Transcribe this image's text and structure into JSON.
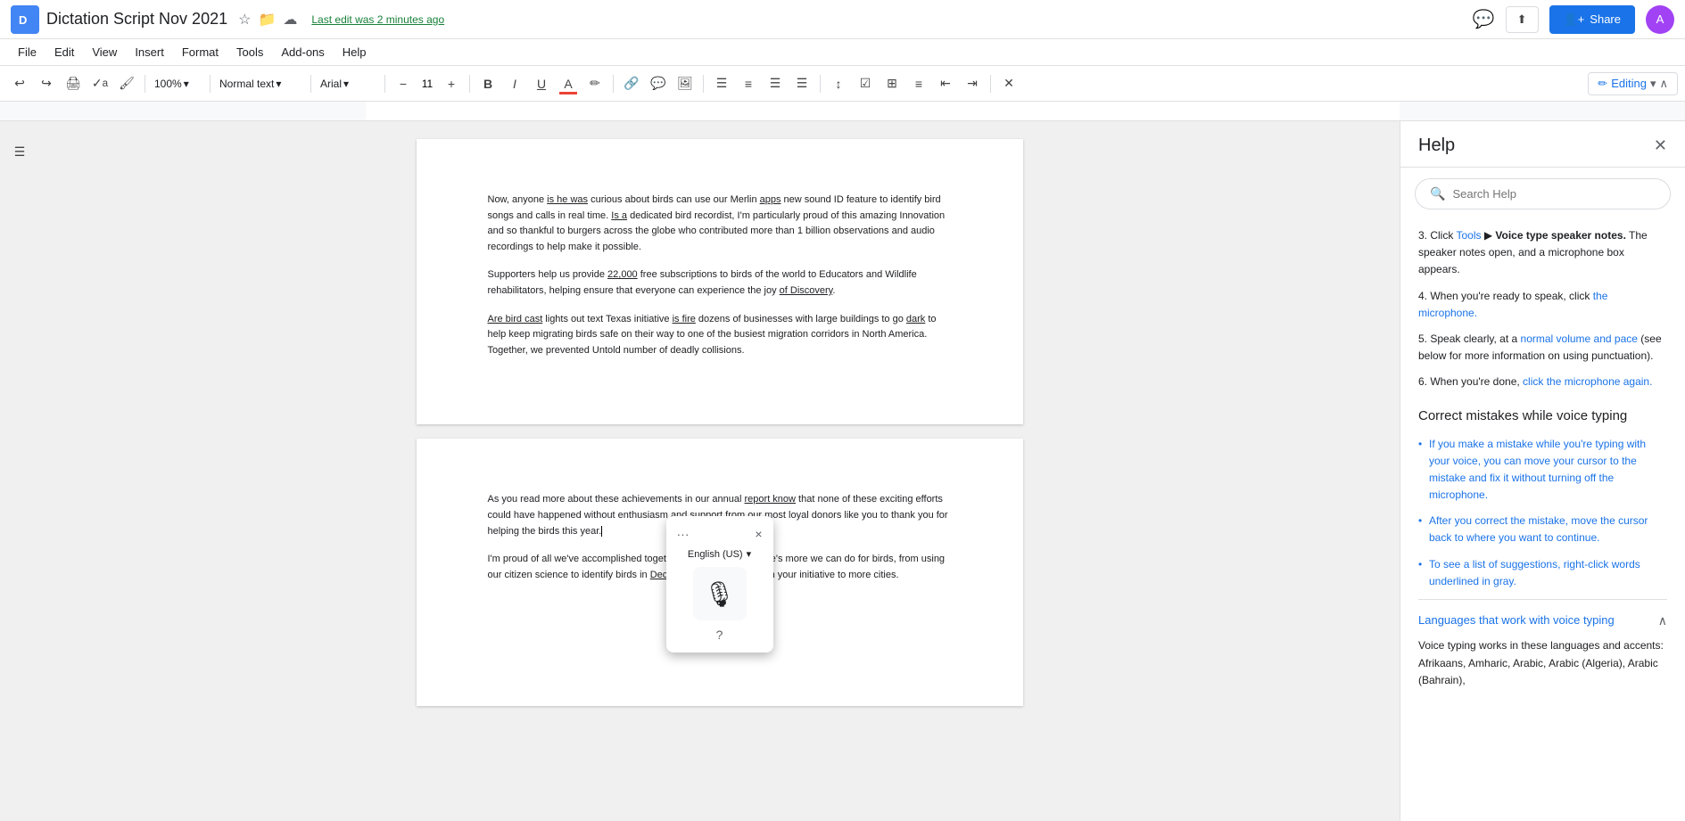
{
  "titleBar": {
    "appIcon": "D",
    "docTitle": "Dictation Script Nov 2021",
    "lastEdit": "Last edit was 2 minutes ago",
    "shareLabel": "Share",
    "editingLabel": "Editing",
    "avatar": "A"
  },
  "menuBar": {
    "items": [
      "File",
      "Edit",
      "View",
      "Insert",
      "Format",
      "Tools",
      "Add-ons",
      "Help"
    ]
  },
  "toolbar": {
    "zoom": "100%",
    "style": "Normal text",
    "font": "Arial",
    "fontSize": "11",
    "editingMode": "Editing"
  },
  "page1": {
    "paragraphs": [
      "Now, anyone is he was curious about birds can use our Merlin apps new sound ID feature to identify bird songs and calls in real time. Is a dedicated bird recordist, I'm particularly proud of this amazing Innovation and so thankful to burgers across the globe who contributed more than 1 billion observations and audio recordings to help make it possible.",
      "Supporters help us provide 22,000 free subscriptions to birds of the world to Educators and Wildlife rehabilitators, helping ensure that everyone can experience the joy of Discovery.",
      "Are bird cast lights out text Texas initiative is fire dozens of businesses with large buildings to go dark to help keep migrating birds safe on their way to one of the busiest migration corridors in North America. Together, we prevented Untold number of deadly collisions."
    ]
  },
  "page2": {
    "paragraphs": [
      "As you read more about these achievements in our annual report know that none of these exciting efforts could have happened without enthusiasm and support from our most loyal donors like you to thank you for helping the birds this year.",
      "I'm proud of all we've accomplished together, but I also know there's more we can do for birds, from using our citizen science to identify birds in Decline to taking lights out in your initiative to more cities."
    ]
  },
  "voicePopup": {
    "language": "English (US)",
    "micSymbol": "🎤",
    "helpSymbol": "?",
    "closeSymbol": "×",
    "dotsSymbol": "···"
  },
  "helpPanel": {
    "title": "Help",
    "searchPlaceholder": "Search Help",
    "steps": [
      {
        "num": "3.",
        "text": "Click ",
        "linkText": "Tools",
        "arrow": " ▶ ",
        "rest": "Voice type speaker notes.",
        "detail": " The speaker notes open, and a microphone box appears."
      },
      {
        "num": "4.",
        "text": "When you're ready to speak, click the microphone."
      },
      {
        "num": "5.",
        "text": "Speak clearly, at a normal volume and pace (see below for more information on using punctuation)."
      },
      {
        "num": "6.",
        "text": "When you're done, click the microphone again."
      }
    ],
    "correctSection": {
      "title": "Correct mistakes while voice typing",
      "bullets": [
        "If you make a mistake while you're typing with your voice, you can move your cursor to the mistake and fix it without turning off the microphone.",
        "After you correct the mistake, move the cursor back to where you want to continue.",
        "To see a list of suggestions, right-click words underlined in gray."
      ]
    },
    "languagesSection": {
      "title": "Languages that work with voice typing",
      "content": "Voice typing works in these languages and accents:",
      "examples": "Afrikaans, Amharic, Arabic, Arabic (Algeria), Arabic (Bahrain),"
    }
  }
}
